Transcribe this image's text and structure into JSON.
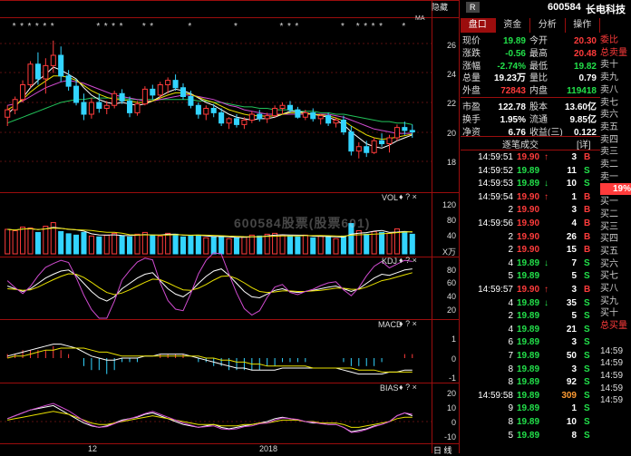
{
  "toolbar": {
    "hide_label": "隐藏",
    "r_badge": "R"
  },
  "stock": {
    "code": "600584",
    "name": "长电科技"
  },
  "tabs": [
    {
      "label": "盘口",
      "active": true
    },
    {
      "label": "资金",
      "active": false
    },
    {
      "label": "分析",
      "active": false
    },
    {
      "label": "操作",
      "active": false
    }
  ],
  "quote_rows": [
    {
      "l1": "现价",
      "v1": "19.89",
      "c1": "green",
      "l2": "今开",
      "v2": "20.30",
      "c2": "red"
    },
    {
      "l1": "涨跌",
      "v1": "-0.56",
      "c1": "green",
      "l2": "最高",
      "v2": "20.48",
      "c2": "red"
    },
    {
      "l1": "涨幅",
      "v1": "-2.74%",
      "c1": "green",
      "l2": "最低",
      "v2": "19.82",
      "c2": "green"
    },
    {
      "l1": "总量",
      "v1": "19.23万",
      "c1": "white",
      "l2": "量比",
      "v2": "0.79",
      "c2": "white"
    },
    {
      "l1": "外盘",
      "v1": "72843",
      "c1": "red",
      "l2": "内盘",
      "v2": "119418",
      "c2": "green"
    },
    {
      "l1": "市盈",
      "v1": "122.78",
      "c1": "white",
      "l2": "股本",
      "v2": "13.60亿",
      "c2": "white"
    },
    {
      "l1": "换手",
      "v1": "1.95%",
      "c1": "white",
      "l2": "流通",
      "v2": "9.85亿",
      "c2": "white"
    },
    {
      "l1": "净资",
      "v1": "6.76",
      "c1": "white",
      "l2": "收益(三)",
      "v2": "0.122",
      "c2": "white"
    }
  ],
  "ticks_header": {
    "title": "逐笔成交",
    "badge": "[详]"
  },
  "ticks": [
    {
      "time": "14:59:51",
      "price": "19.90",
      "pc": "red",
      "arrow": "↑",
      "ac": "red",
      "vol": "3",
      "bs": "B",
      "bc": "red"
    },
    {
      "time": "14:59:52",
      "price": "19.89",
      "pc": "green",
      "arrow": "",
      "ac": "red",
      "vol": "11",
      "bs": "S",
      "bc": "green"
    },
    {
      "time": "14:59:53",
      "price": "19.89",
      "pc": "green",
      "arrow": "↓",
      "ac": "green",
      "vol": "10",
      "bs": "S",
      "bc": "green"
    },
    {
      "time": "14:59:54",
      "price": "19.90",
      "pc": "red",
      "arrow": "↑",
      "ac": "red",
      "vol": "1",
      "bs": "B",
      "bc": "red"
    },
    {
      "time": "2",
      "price": "19.90",
      "pc": "red",
      "arrow": "",
      "ac": "red",
      "vol": "3",
      "bs": "B",
      "bc": "red"
    },
    {
      "time": "14:59:56",
      "price": "19.90",
      "pc": "red",
      "arrow": "",
      "ac": "red",
      "vol": "4",
      "bs": "B",
      "bc": "red"
    },
    {
      "time": "2",
      "price": "19.90",
      "pc": "red",
      "arrow": "",
      "ac": "red",
      "vol": "26",
      "bs": "B",
      "bc": "red"
    },
    {
      "time": "2",
      "price": "19.90",
      "pc": "red",
      "arrow": "",
      "ac": "red",
      "vol": "15",
      "bs": "B",
      "bc": "red"
    },
    {
      "time": "4",
      "price": "19.89",
      "pc": "green",
      "arrow": "↓",
      "ac": "green",
      "vol": "7",
      "bs": "S",
      "bc": "green"
    },
    {
      "time": "5",
      "price": "19.89",
      "pc": "green",
      "arrow": "",
      "ac": "red",
      "vol": "5",
      "bs": "S",
      "bc": "green"
    },
    {
      "time": "14:59:57",
      "price": "19.90",
      "pc": "red",
      "arrow": "↑",
      "ac": "red",
      "vol": "3",
      "bs": "B",
      "bc": "red"
    },
    {
      "time": "4",
      "price": "19.89",
      "pc": "green",
      "arrow": "↓",
      "ac": "green",
      "vol": "35",
      "bs": "S",
      "bc": "green"
    },
    {
      "time": "2",
      "price": "19.89",
      "pc": "green",
      "arrow": "",
      "ac": "red",
      "vol": "5",
      "bs": "S",
      "bc": "green"
    },
    {
      "time": "4",
      "price": "19.89",
      "pc": "green",
      "arrow": "",
      "ac": "red",
      "vol": "21",
      "bs": "S",
      "bc": "green"
    },
    {
      "time": "6",
      "price": "19.89",
      "pc": "green",
      "arrow": "",
      "ac": "red",
      "vol": "3",
      "bs": "S",
      "bc": "green"
    },
    {
      "time": "7",
      "price": "19.89",
      "pc": "green",
      "arrow": "",
      "ac": "red",
      "vol": "50",
      "bs": "S",
      "bc": "green"
    },
    {
      "time": "8",
      "price": "19.89",
      "pc": "green",
      "arrow": "",
      "ac": "red",
      "vol": "3",
      "bs": "S",
      "bc": "green"
    },
    {
      "time": "8",
      "price": "19.89",
      "pc": "green",
      "arrow": "",
      "ac": "red",
      "vol": "92",
      "bs": "S",
      "bc": "green"
    },
    {
      "time": "14:59:58",
      "price": "19.89",
      "pc": "green",
      "arrow": "",
      "ac": "red",
      "vol": "309",
      "bs": "S",
      "bc": "green"
    },
    {
      "time": "9",
      "price": "19.89",
      "pc": "green",
      "arrow": "",
      "ac": "red",
      "vol": "1",
      "bs": "S",
      "bc": "green"
    },
    {
      "time": "8",
      "price": "19.89",
      "pc": "green",
      "arrow": "",
      "ac": "red",
      "vol": "10",
      "bs": "S",
      "bc": "green"
    },
    {
      "time": "5",
      "price": "19.89",
      "pc": "green",
      "arrow": "",
      "ac": "red",
      "vol": "8",
      "bs": "S",
      "bc": "green"
    }
  ],
  "side_labels": [
    "委比",
    "总卖量",
    "卖十",
    "卖九",
    "卖八",
    "卖七",
    "卖六",
    "卖五",
    "卖四",
    "卖三",
    "卖二",
    "卖一",
    "19%",
    "买一",
    "买二",
    "买三",
    "买四",
    "买五",
    "买六",
    "买七",
    "买八",
    "买九",
    "买十",
    "总买量",
    "",
    "14:59",
    "14:59",
    "14:59",
    "14:59",
    "14:59"
  ],
  "chart_panels": {
    "main_axis": [
      "26",
      "24",
      "22",
      "20",
      "18"
    ],
    "vol_label": "VOL",
    "vol_axis": [
      "120",
      "80",
      "40"
    ],
    "vol_unit": "X万",
    "kdj_label": "KDJ",
    "kdj_axis": [
      "80",
      "60",
      "40",
      "20"
    ],
    "macd_label": "MACD",
    "macd_axis": [
      "1",
      "0",
      "-1"
    ],
    "bias_label": "BIAS",
    "bias_axis": [
      "20",
      "10",
      "0",
      "-10"
    ],
    "x_labels": [
      "12",
      "2018"
    ],
    "bottom_right": "日 线",
    "controls": "♦ ? ×",
    "ma_label": "MA",
    "watermark": "600584股票(股票601)"
  },
  "chart_data": {
    "type": "candlestick",
    "ylim": [
      17,
      27
    ],
    "candles": [
      [
        21.0,
        21.8,
        20.4,
        21.5
      ],
      [
        21.5,
        22.4,
        21.2,
        22.2
      ],
      [
        22.2,
        23.5,
        22.0,
        23.2
      ],
      [
        23.2,
        24.8,
        23.0,
        24.6
      ],
      [
        24.6,
        25.4,
        23.2,
        23.6
      ],
      [
        23.6,
        25.0,
        22.6,
        24.5
      ],
      [
        24.5,
        26.2,
        24.0,
        25.2
      ],
      [
        25.2,
        25.8,
        23.4,
        23.8
      ],
      [
        23.8,
        24.2,
        22.8,
        23.1
      ],
      [
        23.1,
        23.6,
        21.8,
        22.0
      ],
      [
        22.0,
        22.6,
        20.8,
        21.2
      ],
      [
        21.2,
        22.3,
        20.9,
        22.0
      ],
      [
        22.0,
        22.6,
        21.3,
        21.6
      ],
      [
        21.6,
        22.1,
        21.2,
        21.8
      ],
      [
        21.8,
        22.8,
        21.6,
        22.6
      ],
      [
        22.6,
        22.9,
        21.9,
        22.1
      ],
      [
        22.1,
        22.4,
        21.0,
        21.3
      ],
      [
        21.3,
        22.1,
        21.1,
        21.9
      ],
      [
        21.9,
        23.1,
        21.8,
        22.9
      ],
      [
        22.9,
        23.2,
        22.2,
        22.5
      ],
      [
        22.5,
        23.4,
        22.3,
        23.2
      ],
      [
        23.2,
        23.7,
        22.6,
        23.5
      ],
      [
        23.5,
        23.9,
        22.8,
        23.0
      ],
      [
        23.0,
        23.3,
        22.2,
        22.4
      ],
      [
        22.4,
        22.8,
        21.6,
        21.8
      ],
      [
        21.8,
        22.0,
        20.9,
        21.2
      ],
      [
        21.2,
        21.8,
        20.8,
        21.6
      ],
      [
        21.6,
        21.9,
        21.0,
        21.3
      ],
      [
        21.3,
        21.6,
        20.4,
        20.6
      ],
      [
        20.6,
        21.0,
        20.2,
        20.9
      ],
      [
        20.9,
        21.2,
        20.3,
        20.5
      ],
      [
        20.5,
        21.0,
        20.2,
        20.8
      ],
      [
        20.8,
        21.4,
        20.6,
        21.2
      ],
      [
        21.2,
        21.5,
        20.7,
        20.9
      ],
      [
        20.9,
        21.3,
        20.6,
        21.1
      ],
      [
        21.1,
        21.8,
        21.0,
        21.6
      ],
      [
        21.6,
        22.0,
        21.2,
        21.8
      ],
      [
        21.8,
        22.1,
        21.3,
        21.5
      ],
      [
        21.5,
        21.7,
        20.9,
        21.0
      ],
      [
        21.0,
        21.5,
        20.8,
        21.3
      ],
      [
        21.3,
        21.6,
        20.7,
        20.9
      ],
      [
        20.9,
        21.2,
        20.5,
        21.1
      ],
      [
        21.1,
        21.3,
        20.4,
        20.6
      ],
      [
        20.6,
        21.0,
        20.3,
        20.8
      ],
      [
        20.8,
        21.1,
        19.8,
        20.0
      ],
      [
        20.0,
        20.4,
        18.4,
        18.7
      ],
      [
        18.7,
        19.3,
        18.2,
        19.0
      ],
      [
        19.0,
        19.4,
        18.3,
        18.6
      ],
      [
        18.6,
        19.6,
        18.5,
        19.4
      ],
      [
        19.4,
        19.9,
        19.0,
        19.2
      ],
      [
        19.2,
        19.8,
        18.6,
        19.6
      ],
      [
        19.6,
        20.5,
        19.4,
        20.3
      ],
      [
        20.3,
        20.7,
        19.8,
        20.1
      ],
      [
        20.1,
        20.5,
        19.6,
        20.0
      ]
    ],
    "ma1": [
      21.2,
      21.7,
      22.3,
      23.0,
      23.5,
      23.9,
      24.4,
      24.2,
      23.9,
      23.6,
      23.0,
      22.5,
      22.2,
      22.0,
      21.9,
      22.0,
      21.9,
      21.8,
      21.9,
      22.1,
      22.4,
      22.7,
      22.9,
      22.8,
      22.6,
      22.3,
      22.0,
      21.8,
      21.5,
      21.2,
      21.0,
      20.9,
      20.8,
      20.9,
      20.9,
      21.0,
      21.2,
      21.4,
      21.4,
      21.3,
      21.2,
      21.1,
      21.0,
      20.8,
      20.5,
      20.0,
      19.6,
      19.2,
      19.0,
      18.9,
      19.1,
      19.4,
      19.6,
      19.8
    ],
    "ma2": [
      21.8,
      21.9,
      22.1,
      22.4,
      22.7,
      23.0,
      23.2,
      23.4,
      23.5,
      23.4,
      23.3,
      23.1,
      22.9,
      22.7,
      22.5,
      22.4,
      22.3,
      22.2,
      22.1,
      22.1,
      22.2,
      22.3,
      22.4,
      22.5,
      22.5,
      22.4,
      22.3,
      22.2,
      22.0,
      21.8,
      21.7,
      21.5,
      21.4,
      21.3,
      21.2,
      21.2,
      21.2,
      21.2,
      21.2,
      21.2,
      21.2,
      21.2,
      21.2,
      21.1,
      21.0,
      20.8,
      20.6,
      20.4,
      20.2,
      20.1,
      20.0,
      19.9,
      19.9,
      19.9
    ],
    "ma3": [
      20.6,
      20.8,
      21.0,
      21.2,
      21.4,
      21.6,
      21.8,
      22.0,
      22.1,
      22.2,
      22.2,
      22.3,
      22.3,
      22.3,
      22.3,
      22.3,
      22.2,
      22.2,
      22.2,
      22.2,
      22.2,
      22.2,
      22.2,
      22.2,
      22.2,
      22.1,
      22.1,
      22.0,
      22.0,
      21.9,
      21.8,
      21.7,
      21.7,
      21.6,
      21.6,
      21.5,
      21.5,
      21.5,
      21.4,
      21.4,
      21.4,
      21.3,
      21.3,
      21.2,
      21.2,
      21.1,
      21.0,
      20.9,
      20.8,
      20.7,
      20.7,
      20.6,
      20.6,
      20.5
    ],
    "volumes": [
      55,
      52,
      60,
      58,
      48,
      62,
      70,
      50,
      45,
      42,
      48,
      40,
      38,
      42,
      46,
      40,
      38,
      44,
      48,
      42,
      40,
      46,
      44,
      38,
      40,
      42,
      36,
      38,
      40,
      34,
      36,
      38,
      42,
      40,
      44,
      46,
      42,
      40,
      38,
      42,
      36,
      40,
      38,
      34,
      40,
      68,
      52,
      44,
      50,
      48,
      46,
      56,
      50,
      44
    ],
    "kdj_k": [
      50,
      45,
      40,
      45,
      55,
      65,
      72,
      78,
      80,
      70,
      55,
      40,
      28,
      22,
      30,
      45,
      55,
      65,
      72,
      75,
      60,
      45,
      35,
      30,
      40,
      55,
      68,
      78,
      82,
      70,
      55,
      40,
      30,
      28,
      35,
      42,
      45,
      40,
      38,
      40,
      42,
      45,
      48,
      50,
      45,
      40,
      45,
      55,
      65,
      72,
      70,
      75,
      80,
      82
    ],
    "kdj_d": [
      45,
      44,
      42,
      43,
      48,
      55,
      62,
      68,
      73,
      72,
      66,
      57,
      47,
      38,
      34,
      37,
      43,
      50,
      57,
      63,
      62,
      56,
      49,
      43,
      42,
      46,
      53,
      61,
      68,
      69,
      64,
      56,
      47,
      40,
      38,
      39,
      41,
      41,
      40,
      40,
      41,
      42,
      44,
      46,
      46,
      44,
      44,
      48,
      54,
      60,
      63,
      67,
      71,
      75
    ],
    "kdj_j": [
      60,
      47,
      36,
      49,
      69,
      85,
      92,
      98,
      94,
      66,
      33,
      6,
      -10,
      -10,
      22,
      61,
      79,
      95,
      102,
      99,
      56,
      23,
      7,
      4,
      36,
      73,
      98,
      112,
      110,
      72,
      37,
      8,
      -4,
      4,
      29,
      48,
      53,
      38,
      34,
      40,
      44,
      51,
      56,
      58,
      43,
      32,
      47,
      69,
      87,
      96,
      84,
      91,
      98,
      96
    ],
    "macd_dif": [
      0.1,
      0.2,
      0.3,
      0.4,
      0.5,
      0.6,
      0.7,
      0.7,
      0.6,
      0.5,
      0.3,
      0.1,
      0.0,
      -0.1,
      -0.1,
      0.0,
      0.0,
      0.0,
      0.1,
      0.1,
      0.2,
      0.2,
      0.2,
      0.2,
      0.1,
      0.0,
      -0.1,
      -0.2,
      -0.3,
      -0.4,
      -0.5,
      -0.5,
      -0.6,
      -0.6,
      -0.6,
      -0.6,
      -0.5,
      -0.5,
      -0.5,
      -0.5,
      -0.5,
      -0.5,
      -0.5,
      -0.5,
      -0.6,
      -0.7,
      -0.8,
      -0.8,
      -0.8,
      -0.8,
      -0.7,
      -0.7,
      -0.6,
      -0.6
    ],
    "macd_dea": [
      0.0,
      0.1,
      0.1,
      0.2,
      0.3,
      0.4,
      0.4,
      0.5,
      0.5,
      0.5,
      0.5,
      0.4,
      0.3,
      0.3,
      0.2,
      0.1,
      0.1,
      0.1,
      0.1,
      0.1,
      0.1,
      0.1,
      0.1,
      0.1,
      0.1,
      0.1,
      0.0,
      0.0,
      -0.1,
      -0.1,
      -0.2,
      -0.2,
      -0.3,
      -0.3,
      -0.4,
      -0.4,
      -0.4,
      -0.4,
      -0.4,
      -0.4,
      -0.5,
      -0.5,
      -0.5,
      -0.5,
      -0.5,
      -0.5,
      -0.6,
      -0.6,
      -0.6,
      -0.7,
      -0.7,
      -0.7,
      -0.7,
      -0.7
    ],
    "bias1": [
      2,
      4,
      6,
      8,
      9,
      10,
      11,
      8,
      5,
      2,
      -1,
      -3,
      -4,
      -3,
      -1,
      1,
      2,
      3,
      5,
      6,
      4,
      2,
      0,
      -2,
      -3,
      -4,
      -3,
      -2,
      -4,
      -5,
      -4,
      -3,
      -2,
      -1,
      0,
      2,
      3,
      2,
      1,
      0,
      -1,
      -1,
      -2,
      -2,
      -4,
      -7,
      -6,
      -5,
      -3,
      -2,
      0,
      4,
      6,
      4
    ],
    "bias2": [
      1,
      2,
      3,
      4,
      5,
      6,
      7,
      6,
      5,
      3,
      1,
      -1,
      -2,
      -2,
      -1,
      0,
      1,
      2,
      3,
      4,
      3,
      2,
      1,
      0,
      -1,
      -2,
      -2,
      -2,
      -3,
      -3,
      -3,
      -2,
      -2,
      -1,
      -1,
      0,
      1,
      1,
      1,
      0,
      0,
      -1,
      -1,
      -1,
      -2,
      -4,
      -4,
      -3,
      -2,
      -1,
      0,
      2,
      3,
      3
    ]
  }
}
